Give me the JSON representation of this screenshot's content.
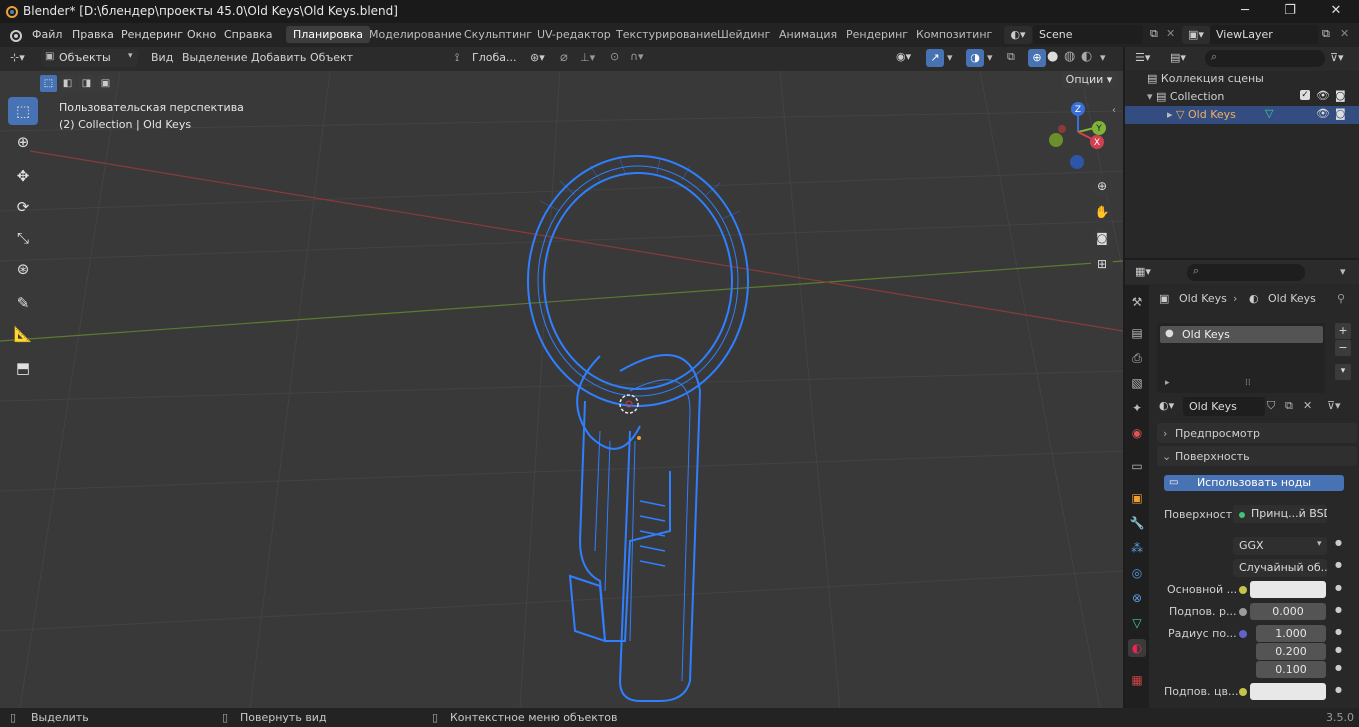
{
  "window": {
    "title": "Blender* [D:\\блендер\\проекты 45.0\\Old Keys\\Old Keys.blend]"
  },
  "menu": [
    "Файл",
    "Правка",
    "Рендеринг",
    "Окно",
    "Справка"
  ],
  "workspaces": [
    "Планировка",
    "Моделирование",
    "Скульптинг",
    "UV-редактор",
    "Текстурирование",
    "Шейдинг",
    "Анимация",
    "Рендеринг",
    "Композитинг"
  ],
  "scene": {
    "name": "Scene",
    "view_layer": "ViewLayer"
  },
  "viewport_header": {
    "mode": "Объекты",
    "menus": [
      "Вид",
      "Выделение",
      "Добавить",
      "Объект"
    ],
    "transform_orientation": "Глоба...",
    "options_label": "Опции"
  },
  "viewport": {
    "perspective_label": "Пользовательская перспектива",
    "collection_label": "(2) Collection | Old Keys",
    "gizmo_axes": [
      "Z",
      "Y",
      "X"
    ]
  },
  "outliner": {
    "root": "Коллекция сцены",
    "collection": "Collection",
    "object": "Old Keys"
  },
  "properties": {
    "breadcrumb_object": "Old Keys",
    "breadcrumb_material": "Old Keys",
    "slot_name": "Old Keys",
    "material_name": "Old Keys",
    "sections": {
      "preview": "Предпросмотр",
      "surface": "Поверхность"
    },
    "use_nodes_button": "Использовать ноды",
    "surface_label": "Поверхность",
    "surface_value": "Принц...й BSDF",
    "distribution": "GGX",
    "subsurface_method": "Случайный об...",
    "base_color_label": "Основной ...",
    "subsurface_label": "Подпов. р...",
    "subsurface_value": "0.000",
    "radius_label": "Радиус по...",
    "radius_values": [
      "1.000",
      "0.200",
      "0.100"
    ],
    "subsurface_color_label": "Подпов. цв..."
  },
  "statusbar": {
    "select": "Выделить",
    "rotate": "Повернуть вид",
    "context": "Контекстное меню объектов",
    "version": "3.5.0"
  },
  "colors": {
    "accent": "#4772b3",
    "wire": "#2f7fff",
    "grid_x": "#8a3a3a",
    "grid_y": "#5d7a2f"
  }
}
